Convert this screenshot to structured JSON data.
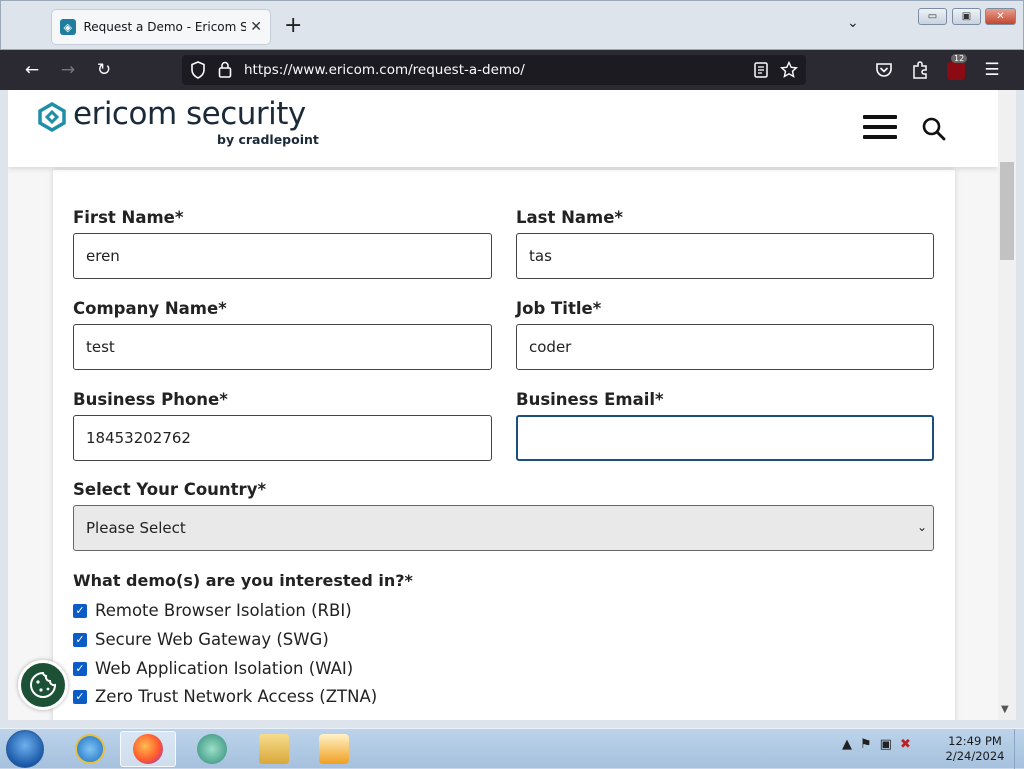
{
  "browser": {
    "tab_title": "Request a Demo - Ericom Softw",
    "tab_close": "✕",
    "new_tab": "+",
    "list_tabs": "⌄",
    "url": "https://www.ericom.com/request-a-demo/",
    "extension_badge": "12",
    "window_controls": {
      "minimize": "▭",
      "maximize": "▣",
      "close": "✕"
    }
  },
  "site": {
    "logo_text": "ericom security",
    "logo_sub": "by cradlepoint"
  },
  "form": {
    "first_name": {
      "label": "First Name*",
      "value": "eren"
    },
    "last_name": {
      "label": "Last Name*",
      "value": "tas"
    },
    "company": {
      "label": "Company Name*",
      "value": "test"
    },
    "job_title": {
      "label": "Job Title*",
      "value": "coder"
    },
    "phone": {
      "label": "Business Phone*",
      "value": "18453202762"
    },
    "email": {
      "label": "Business Email*",
      "value": ""
    },
    "country": {
      "label": "Select Your Country*",
      "value": "Please Select"
    },
    "demos_label": "What demo(s) are you interested in?*",
    "demos": [
      {
        "label": "Remote Browser Isolation (RBI)",
        "checked": true
      },
      {
        "label": "Secure Web Gateway (SWG)",
        "checked": true
      },
      {
        "label": "Web Application Isolation (WAI)",
        "checked": true
      },
      {
        "label": "Zero Trust Network Access (ZTNA)",
        "checked": true
      }
    ]
  },
  "taskbar": {
    "clock_time": "12:49 PM",
    "clock_date": "2/24/2024"
  },
  "colors": {
    "nav_bg": "#2b2a33",
    "checkbox": "#0b5cc7",
    "focus_border": "#1b4f7d",
    "cookie_button": "#1d5136"
  }
}
